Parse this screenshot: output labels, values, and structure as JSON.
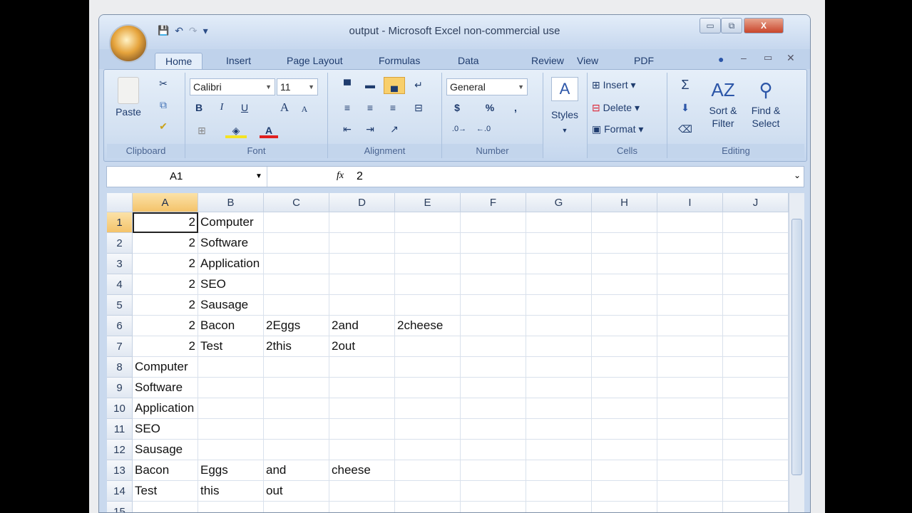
{
  "window": {
    "title": "output - Microsoft Excel non-commercial use",
    "minimize": "▭",
    "restore": "⧉",
    "close": "X"
  },
  "qat": {
    "save": "💾",
    "undo": "↶",
    "redo": "↷",
    "more": "▾"
  },
  "tabs": [
    "Home",
    "Insert",
    "Page Layout",
    "Formulas",
    "Data",
    "Review",
    "View",
    "PDF"
  ],
  "ribbon": {
    "clipboard": {
      "label": "Clipboard",
      "paste": "Paste"
    },
    "font": {
      "label": "Font",
      "name": "Calibri",
      "size": "11",
      "bold": "B",
      "italic": "I",
      "underline": "U",
      "grow": "A",
      "shrink": "A"
    },
    "alignment": {
      "label": "Alignment"
    },
    "number": {
      "label": "Number",
      "format": "General",
      "currency": "$",
      "percent": "%",
      "comma": ","
    },
    "styles": {
      "label": "Styles"
    },
    "cells": {
      "label": "Cells",
      "insert": "Insert",
      "delete": "Delete",
      "format": "Format"
    },
    "editing": {
      "label": "Editing",
      "sum": "Σ",
      "sort": "Sort &\nFilter",
      "find": "Find &\nSelect"
    }
  },
  "formula_bar": {
    "name_box": "A1",
    "fx": "fx",
    "value": "2"
  },
  "sheet": {
    "columns": [
      "A",
      "B",
      "C",
      "D",
      "E",
      "F",
      "G",
      "H",
      "I",
      "J"
    ],
    "selected_column": "A",
    "selected_row": 1,
    "rows": [
      [
        2,
        "Computer",
        "",
        "",
        "",
        "",
        "",
        "",
        "",
        ""
      ],
      [
        2,
        "Software",
        "",
        "",
        "",
        "",
        "",
        "",
        "",
        ""
      ],
      [
        2,
        "Application",
        "",
        "",
        "",
        "",
        "",
        "",
        "",
        ""
      ],
      [
        2,
        "SEO",
        "",
        "",
        "",
        "",
        "",
        "",
        "",
        ""
      ],
      [
        2,
        "Sausage",
        "",
        "",
        "",
        "",
        "",
        "",
        "",
        ""
      ],
      [
        2,
        "Bacon",
        "2Eggs",
        "2and",
        "2cheese",
        "",
        "",
        "",
        "",
        ""
      ],
      [
        2,
        "Test",
        "2this",
        "2out",
        "",
        "",
        "",
        "",
        "",
        ""
      ],
      [
        "Computer",
        "",
        "",
        "",
        "",
        "",
        "",
        "",
        "",
        ""
      ],
      [
        "Software",
        "",
        "",
        "",
        "",
        "",
        "",
        "",
        "",
        ""
      ],
      [
        "Application",
        "",
        "",
        "",
        "",
        "",
        "",
        "",
        "",
        ""
      ],
      [
        "SEO",
        "",
        "",
        "",
        "",
        "",
        "",
        "",
        "",
        ""
      ],
      [
        "Sausage",
        "",
        "",
        "",
        "",
        "",
        "",
        "",
        "",
        ""
      ],
      [
        "Bacon",
        "Eggs",
        "and",
        "cheese",
        "",
        "",
        "",
        "",
        "",
        ""
      ],
      [
        "Test",
        "this",
        "out",
        "",
        "",
        "",
        "",
        "",
        "",
        ""
      ],
      [
        "",
        "",
        "",
        "",
        "",
        "",
        "",
        "",
        "",
        ""
      ]
    ]
  }
}
